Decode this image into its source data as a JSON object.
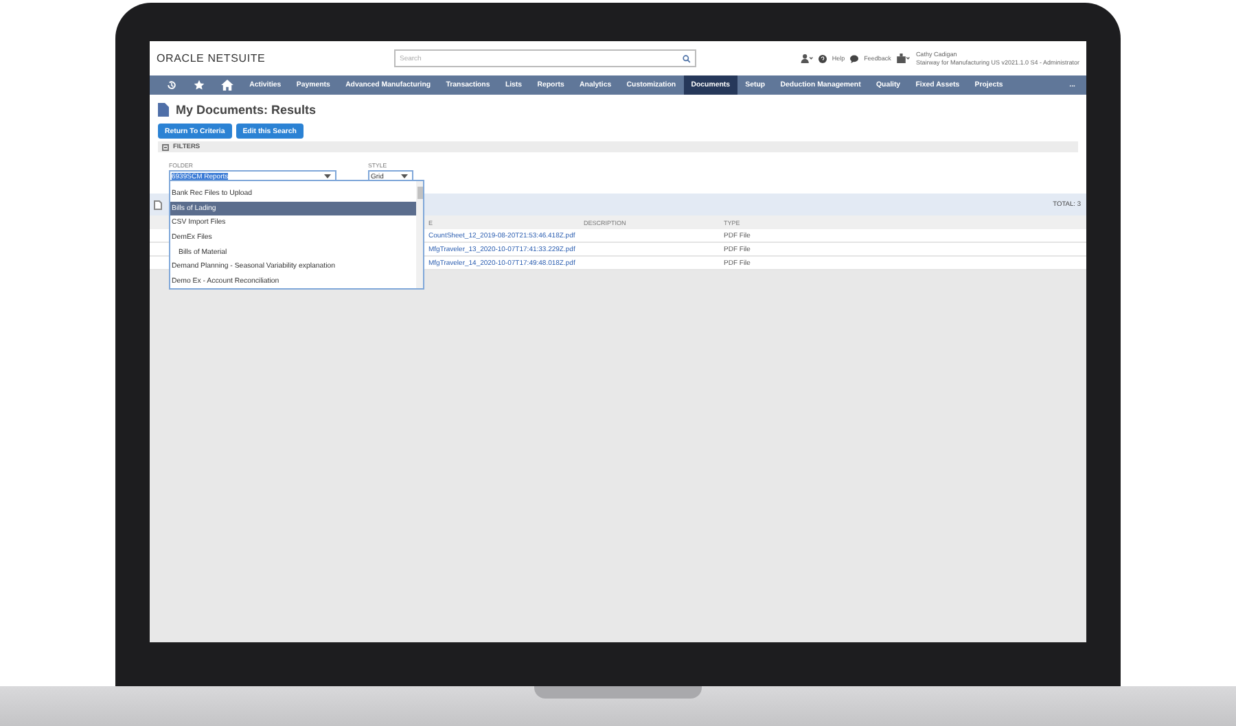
{
  "header": {
    "logo": "ORACLE NETSUITE",
    "search": {
      "placeholder": "Search"
    },
    "help": "Help",
    "feedback": "Feedback",
    "user": {
      "name": "Cathy Cadigan",
      "role": "Stairway for Manufacturing US v2021.1.0 S4 - Administrator"
    }
  },
  "nav": {
    "items": [
      {
        "label": "Activities",
        "selected": false
      },
      {
        "label": "Payments",
        "selected": false
      },
      {
        "label": "Advanced Manufacturing",
        "selected": false
      },
      {
        "label": "Transactions",
        "selected": false
      },
      {
        "label": "Lists",
        "selected": false
      },
      {
        "label": "Reports",
        "selected": false
      },
      {
        "label": "Analytics",
        "selected": false
      },
      {
        "label": "Customization",
        "selected": false
      },
      {
        "label": "Documents",
        "selected": true
      },
      {
        "label": "Setup",
        "selected": false
      },
      {
        "label": "Deduction Management",
        "selected": false
      },
      {
        "label": "Quality",
        "selected": false
      },
      {
        "label": "Fixed Assets",
        "selected": false
      },
      {
        "label": "Projects",
        "selected": false
      }
    ],
    "more": "..."
  },
  "page": {
    "title": "My Documents: Results",
    "buttons": [
      "Return To Criteria",
      "Edit this Search"
    ],
    "filters": {
      "title": "FILTERS",
      "folder": {
        "label": "FOLDER",
        "value": "6939SCM Reports"
      },
      "style": {
        "label": "STYLE",
        "value": "Grid"
      }
    },
    "folder_dropdown": {
      "options": [
        {
          "label": "Bank Rec Files to Upload",
          "selected": false
        },
        {
          "label": "Bills of Lading",
          "selected": true
        },
        {
          "label": "CSV Import Files",
          "selected": false
        },
        {
          "label": "DemEx Files",
          "selected": false,
          "children": [
            {
              "label": "Bills of Material",
              "selected": false
            }
          ]
        },
        {
          "label": "Demand Planning - Seasonal Variability explanation",
          "selected": false
        },
        {
          "label": "Demo Ex - Account Reconciliation",
          "selected": false
        }
      ]
    },
    "results": {
      "total": "TOTAL: 3",
      "columns": [
        "E",
        "DESCRIPTION",
        "TYPE"
      ],
      "rows": [
        {
          "name": "CountSheet_12_2019-08-20T21:53:46.418Z.pdf",
          "type": "PDF File"
        },
        {
          "name": "MfgTraveler_13_2020-10-07T17:41:33.229Z.pdf",
          "type": "PDF File"
        },
        {
          "name": "MfgTraveler_14_2020-10-07T17:49:48.018Z.pdf",
          "type": "PDF File"
        }
      ]
    }
  }
}
